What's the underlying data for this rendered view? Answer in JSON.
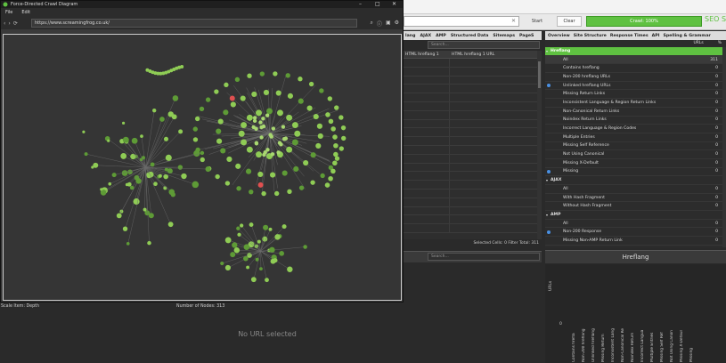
{
  "window": {
    "title": "Force-Directed Crawl Diagram",
    "menu": [
      "File",
      "Edit"
    ],
    "url": "https://www.screamingfrog.co.uk/",
    "status_left": "Scale Item: Depth",
    "status_right": "Number of Nodes: 313"
  },
  "toolbar": {
    "start_label": "Start",
    "clear_label": "Clear",
    "crawl_label": "Crawl: 100%",
    "logo": "SEO Sp"
  },
  "center": {
    "tabs": [
      "lang",
      "AJAX",
      "AMP",
      "Structured Data",
      "Sitemaps",
      "PageS"
    ],
    "search_placeholder": "Search...",
    "headers": [
      "HTML hreflang 1",
      "HTML hreflang 1 URL"
    ],
    "status": "Selected Cells: 0  Filter Total: 311",
    "lower_search_placeholder": "Search...",
    "empty_message": "No URL selected"
  },
  "right": {
    "tabs": [
      "Overview",
      "Site Structure",
      "Response Times",
      "API",
      "Spelling & Grammar"
    ],
    "col_urls": "URLs",
    "col_pct": "%",
    "rows": [
      {
        "label": "Hreflang",
        "value": "",
        "type": "section"
      },
      {
        "label": "All",
        "value": "311",
        "type": "sub-active"
      },
      {
        "label": "Contains hreflang",
        "value": "0",
        "type": "row"
      },
      {
        "label": "Non-200 hreflang URLs",
        "value": "0",
        "type": "row"
      },
      {
        "label": "Unlinked hreflang URLs",
        "value": "0",
        "type": "row",
        "info": true
      },
      {
        "label": "Missing Return Links",
        "value": "0",
        "type": "row"
      },
      {
        "label": "Inconsistent Language & Region Return Links",
        "value": "0",
        "type": "row"
      },
      {
        "label": "Non-Canonical Return Links",
        "value": "0",
        "type": "row"
      },
      {
        "label": "Noindex Return Links",
        "value": "0",
        "type": "row"
      },
      {
        "label": "Incorrect Language & Region Codes",
        "value": "0",
        "type": "row"
      },
      {
        "label": "Multiple Entries",
        "value": "0",
        "type": "row"
      },
      {
        "label": "Missing Self Reference",
        "value": "0",
        "type": "row"
      },
      {
        "label": "Not Using Canonical",
        "value": "0",
        "type": "row"
      },
      {
        "label": "Missing X-Default",
        "value": "0",
        "type": "row"
      },
      {
        "label": "Missing",
        "value": "0",
        "type": "row",
        "info": true
      },
      {
        "label": "AJAX",
        "value": "",
        "type": "section"
      },
      {
        "label": "All",
        "value": "0",
        "type": "row"
      },
      {
        "label": "With Hash Fragment",
        "value": "0",
        "type": "row"
      },
      {
        "label": "Without Hash Fragment",
        "value": "0",
        "type": "row"
      },
      {
        "label": "AMP",
        "value": "",
        "type": "section"
      },
      {
        "label": "All",
        "value": "0",
        "type": "row"
      },
      {
        "label": "Non-200 Response",
        "value": "0",
        "type": "row",
        "info": true
      },
      {
        "label": "Missing Non-AMP Return Link",
        "value": "0",
        "type": "row"
      }
    ],
    "chart_title": "Hreflang",
    "chart_ylabel": "URLs",
    "chart_zero": "0",
    "chart_xlabels": [
      "Contains hrefla",
      "Non-200 hreflang",
      "Unlinked hreflang",
      "Missing Return",
      "Inconsistent Lang",
      "Non-Canonical Re",
      "Noindex Return",
      "Incorrect Langua",
      "Multiple Entries",
      "Missing Self Ref",
      "Not Using Canon",
      "Missing X-Defaul",
      "Missing"
    ]
  },
  "colors": {
    "accent": "#5fc141",
    "node": "#8fcc55",
    "node_dark": "#5e9b36"
  }
}
